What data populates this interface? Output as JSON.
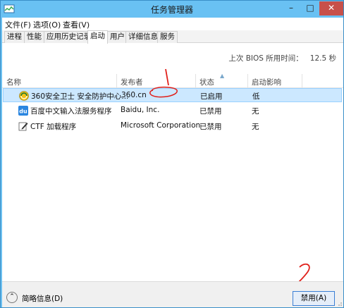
{
  "window": {
    "title": "任务管理器"
  },
  "window_controls": {
    "minimize": "–",
    "maximize": "□",
    "close": "✕"
  },
  "menu": [
    {
      "label": "文件(F)"
    },
    {
      "label": "选项(O)"
    },
    {
      "label": "查看(V)"
    }
  ],
  "tabs": [
    {
      "label": "进程"
    },
    {
      "label": "性能"
    },
    {
      "label": "应用历史记录"
    },
    {
      "label": "启动"
    },
    {
      "label": "用户"
    },
    {
      "label": "详细信息"
    },
    {
      "label": "服务"
    }
  ],
  "active_tab": "启动",
  "bios": {
    "label": "上次 BIOS 所用时间：",
    "value": "12.5 秒"
  },
  "columns": {
    "name": "名称",
    "publisher": "发布者",
    "status": "状态",
    "impact": "启动影响"
  },
  "rows": [
    {
      "name": "360安全卫士 安全防护中心...",
      "publisher": "360.cn",
      "status": "已启用",
      "impact": "低",
      "icon": "360-safeguard-icon",
      "selected": true
    },
    {
      "name": "百度中文输入法服务程序",
      "publisher": "Baidu, Inc.",
      "status": "已禁用",
      "impact": "无",
      "icon": "baidu-du-icon",
      "selected": false
    },
    {
      "name": "CTF 加载程序",
      "publisher": "Microsoft Corporation",
      "status": "已禁用",
      "impact": "无",
      "icon": "ctf-pen-icon",
      "selected": false
    }
  ],
  "footer": {
    "fewer_details": "简略信息(D)",
    "disable_button": "禁用(A)"
  },
  "annotations": {
    "mark_1": "1",
    "mark_2": "2",
    "color": "#e0201a"
  },
  "colors": {
    "titlebar": "#69c1f3",
    "close": "#c7504a",
    "selection": "#cce8ff",
    "accent": "#3a7fd5"
  }
}
